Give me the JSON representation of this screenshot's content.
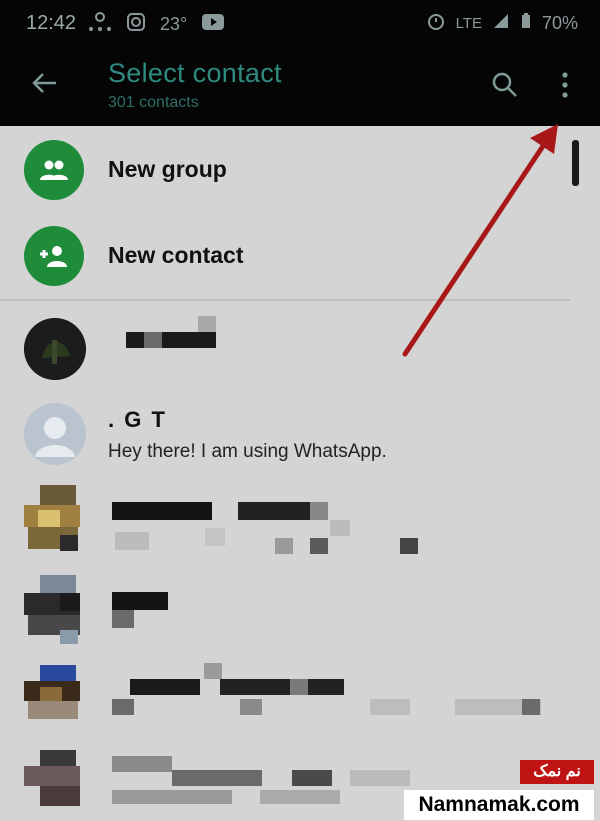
{
  "status_bar": {
    "time": "12:42",
    "temperature": "23°",
    "network": "LTE",
    "battery": "70%"
  },
  "app_bar": {
    "title": "Select contact",
    "subtitle": "301 contacts",
    "back_icon": "arrow-left-icon",
    "search_icon": "search-icon",
    "more_icon": "more-vertical-icon"
  },
  "actions": [
    {
      "label": "New group",
      "icon": "group-icon"
    },
    {
      "label": "New contact",
      "icon": "add-contact-icon"
    }
  ],
  "contacts": [
    {
      "name": "",
      "status": ""
    },
    {
      "name": ". G T",
      "status": "Hey there! I am using WhatsApp."
    },
    {
      "name": "",
      "status": ""
    },
    {
      "name": "",
      "status": ""
    },
    {
      "name": "",
      "status": ""
    },
    {
      "name": "",
      "status": ""
    }
  ],
  "watermark": {
    "persian": "نم نمک",
    "site": "Namnamak.com"
  },
  "colors": {
    "accent_green": "#1f8c3a",
    "appbar_bg": "#050505",
    "title_teal": "#2f8a80",
    "annotation_red": "#c01414"
  }
}
